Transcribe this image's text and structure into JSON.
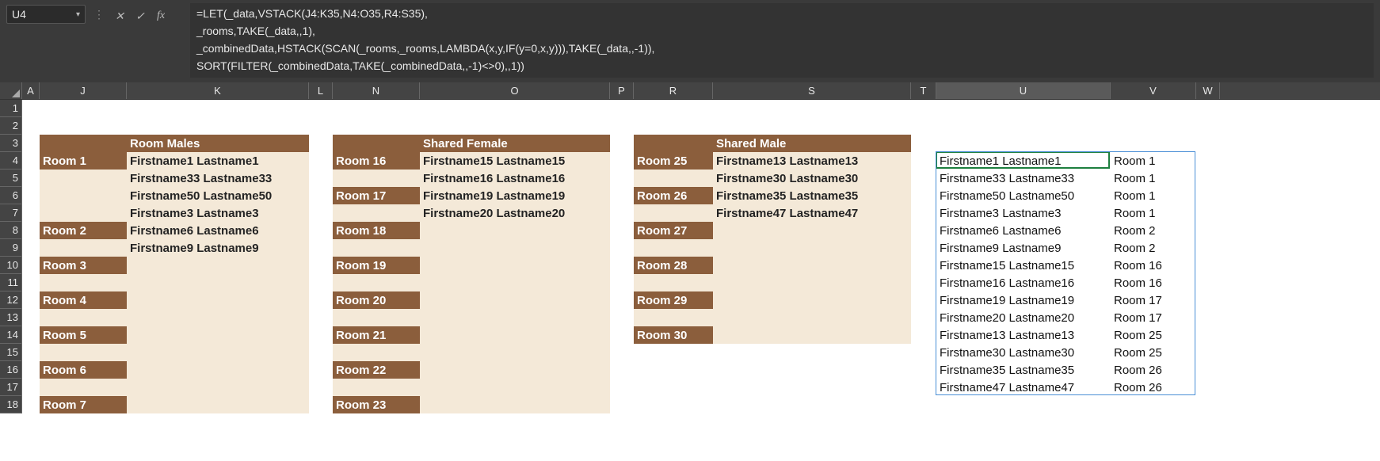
{
  "namebox": "U4",
  "fx_label": "fx",
  "formula_lines": [
    "=LET(_data,VSTACK(J4:K35,N4:O35,R4:S35),",
    "_rooms,TAKE(_data,,1),",
    "_combinedData,HSTACK(SCAN(_rooms,_rooms,LAMBDA(x,y,IF(y=0,x,y))),TAKE(_data,,-1)),",
    "SORT(FILTER(_combinedData,TAKE(_combinedData,,-1)<>0),,1))"
  ],
  "columns": [
    "A",
    "J",
    "K",
    "L",
    "N",
    "O",
    "P",
    "R",
    "S",
    "T",
    "U",
    "V",
    "W"
  ],
  "active_column": "U",
  "row_numbers": [
    1,
    2,
    3,
    4,
    5,
    6,
    7,
    8,
    9,
    10,
    11,
    12,
    13,
    14,
    15,
    16,
    17,
    18
  ],
  "headers": {
    "block1_title": "Room Males",
    "block2_title": "Shared Female",
    "block3_title": "Shared Male"
  },
  "block1": {
    "rows": [
      {
        "room": "Room 1",
        "name": "Firstname1 Lastname1"
      },
      {
        "room": "",
        "name": "Firstname33 Lastname33"
      },
      {
        "room": "",
        "name": "Firstname50 Lastname50"
      },
      {
        "room": "",
        "name": "Firstname3 Lastname3"
      },
      {
        "room": "Room 2",
        "name": "Firstname6 Lastname6"
      },
      {
        "room": "",
        "name": "Firstname9 Lastname9"
      },
      {
        "room": "Room 3",
        "name": ""
      },
      {
        "room": "",
        "name": ""
      },
      {
        "room": "Room 4",
        "name": ""
      },
      {
        "room": "",
        "name": ""
      },
      {
        "room": "Room 5",
        "name": ""
      },
      {
        "room": "",
        "name": ""
      },
      {
        "room": "Room 6",
        "name": ""
      },
      {
        "room": "",
        "name": ""
      },
      {
        "room": "Room 7",
        "name": ""
      }
    ]
  },
  "block2": {
    "rows": [
      {
        "room": "Room 16",
        "name": "Firstname15 Lastname15"
      },
      {
        "room": "",
        "name": "Firstname16 Lastname16"
      },
      {
        "room": "Room 17",
        "name": "Firstname19 Lastname19"
      },
      {
        "room": "",
        "name": "Firstname20 Lastname20"
      },
      {
        "room": "Room 18",
        "name": ""
      },
      {
        "room": "",
        "name": ""
      },
      {
        "room": "Room 19",
        "name": ""
      },
      {
        "room": "",
        "name": ""
      },
      {
        "room": "Room 20",
        "name": ""
      },
      {
        "room": "",
        "name": ""
      },
      {
        "room": "Room 21",
        "name": ""
      },
      {
        "room": "",
        "name": ""
      },
      {
        "room": "Room 22",
        "name": ""
      },
      {
        "room": "",
        "name": ""
      },
      {
        "room": "Room 23",
        "name": ""
      }
    ]
  },
  "block3": {
    "rows": [
      {
        "room": "Room 25",
        "name": "Firstname13 Lastname13"
      },
      {
        "room": "",
        "name": "Firstname30 Lastname30"
      },
      {
        "room": "Room 26",
        "name": "Firstname35 Lastname35"
      },
      {
        "room": "",
        "name": "Firstname47 Lastname47"
      },
      {
        "room": "Room 27",
        "name": ""
      },
      {
        "room": "",
        "name": ""
      },
      {
        "room": "Room 28",
        "name": ""
      },
      {
        "room": "",
        "name": ""
      },
      {
        "room": "Room 29",
        "name": ""
      },
      {
        "room": "",
        "name": ""
      },
      {
        "room": "Room 30",
        "name": ""
      },
      {
        "room": "",
        "name": ""
      },
      {
        "room": "",
        "name": ""
      },
      {
        "room": "",
        "name": ""
      },
      {
        "room": "",
        "name": ""
      }
    ]
  },
  "output": [
    {
      "name": "Firstname1 Lastname1",
      "room": "Room 1"
    },
    {
      "name": "Firstname33 Lastname33",
      "room": "Room 1"
    },
    {
      "name": "Firstname50 Lastname50",
      "room": "Room 1"
    },
    {
      "name": "Firstname3 Lastname3",
      "room": "Room 1"
    },
    {
      "name": "Firstname6 Lastname6",
      "room": "Room 2"
    },
    {
      "name": "Firstname9 Lastname9",
      "room": "Room 2"
    },
    {
      "name": "Firstname15 Lastname15",
      "room": "Room 16"
    },
    {
      "name": "Firstname16 Lastname16",
      "room": "Room 16"
    },
    {
      "name": "Firstname19 Lastname19",
      "room": "Room 17"
    },
    {
      "name": "Firstname20 Lastname20",
      "room": "Room 17"
    },
    {
      "name": "Firstname13 Lastname13",
      "room": "Room 25"
    },
    {
      "name": "Firstname30 Lastname30",
      "room": "Room 25"
    },
    {
      "name": "Firstname35 Lastname35",
      "room": "Room 26"
    },
    {
      "name": "Firstname47 Lastname47",
      "room": "Room 26"
    }
  ],
  "colors": {
    "brown": "#8b5e3c",
    "cream": "#f4e9d8"
  }
}
